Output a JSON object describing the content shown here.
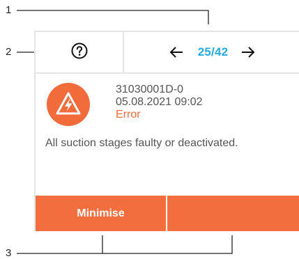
{
  "callouts": {
    "top_nav": "1",
    "help": "2",
    "buttons": "3"
  },
  "topbar": {
    "help_icon": "question-circle-icon",
    "prev_icon": "arrow-left-icon",
    "next_icon": "arrow-right-icon",
    "page_indicator": "25/42"
  },
  "message": {
    "icon": "lightning-warning-icon",
    "code": "31030001D-0",
    "datetime": "05.08.2021 09:02",
    "status": "Error",
    "text": "All suction stages faulty or deactivated."
  },
  "buttons": {
    "minimise_label": "Minimise",
    "second_label": ""
  },
  "colors": {
    "accent_orange": "#f26e3f",
    "page_indicator_blue": "#26aae1",
    "border_gray": "#e4e4e4"
  }
}
